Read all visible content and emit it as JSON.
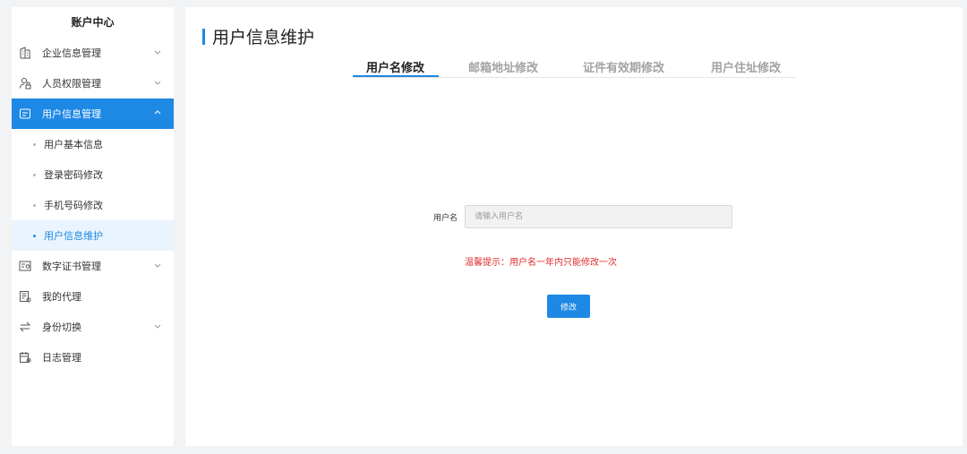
{
  "sidebar": {
    "title": "账户中心",
    "items": [
      {
        "label": "企业信息管理",
        "icon": "building-icon",
        "has_chevron": true
      },
      {
        "label": "人员权限管理",
        "icon": "user-lock-icon",
        "has_chevron": true
      },
      {
        "label": "用户信息管理",
        "icon": "id-card-icon",
        "has_chevron": true,
        "expanded": true
      },
      {
        "label": "数字证书管理",
        "icon": "certificate-icon",
        "has_chevron": true
      },
      {
        "label": "我的代理",
        "icon": "proxy-doc-icon",
        "has_chevron": false
      },
      {
        "label": "身份切换",
        "icon": "switch-icon",
        "has_chevron": true
      },
      {
        "label": "日志管理",
        "icon": "log-calendar-icon",
        "has_chevron": false
      }
    ],
    "sub_items": [
      {
        "label": "用户基本信息"
      },
      {
        "label": "登录密码修改"
      },
      {
        "label": "手机号码修改"
      },
      {
        "label": "用户信息维护",
        "current": true
      }
    ]
  },
  "main": {
    "title": "用户信息维护",
    "tabs": [
      {
        "label": "用户名修改",
        "active": true
      },
      {
        "label": "邮箱地址修改"
      },
      {
        "label": "证件有效期修改"
      },
      {
        "label": "用户住址修改"
      }
    ],
    "form": {
      "username_label": "用户名",
      "username_value": "",
      "username_placeholder": "请输入用户名",
      "tip": "温馨提示：用户名一年内只能修改一次",
      "submit_label": "修改"
    }
  },
  "colors": {
    "accent": "#1e88e5",
    "warning": "#e02b2b",
    "active_sub_bg": "#e9f4fe"
  }
}
